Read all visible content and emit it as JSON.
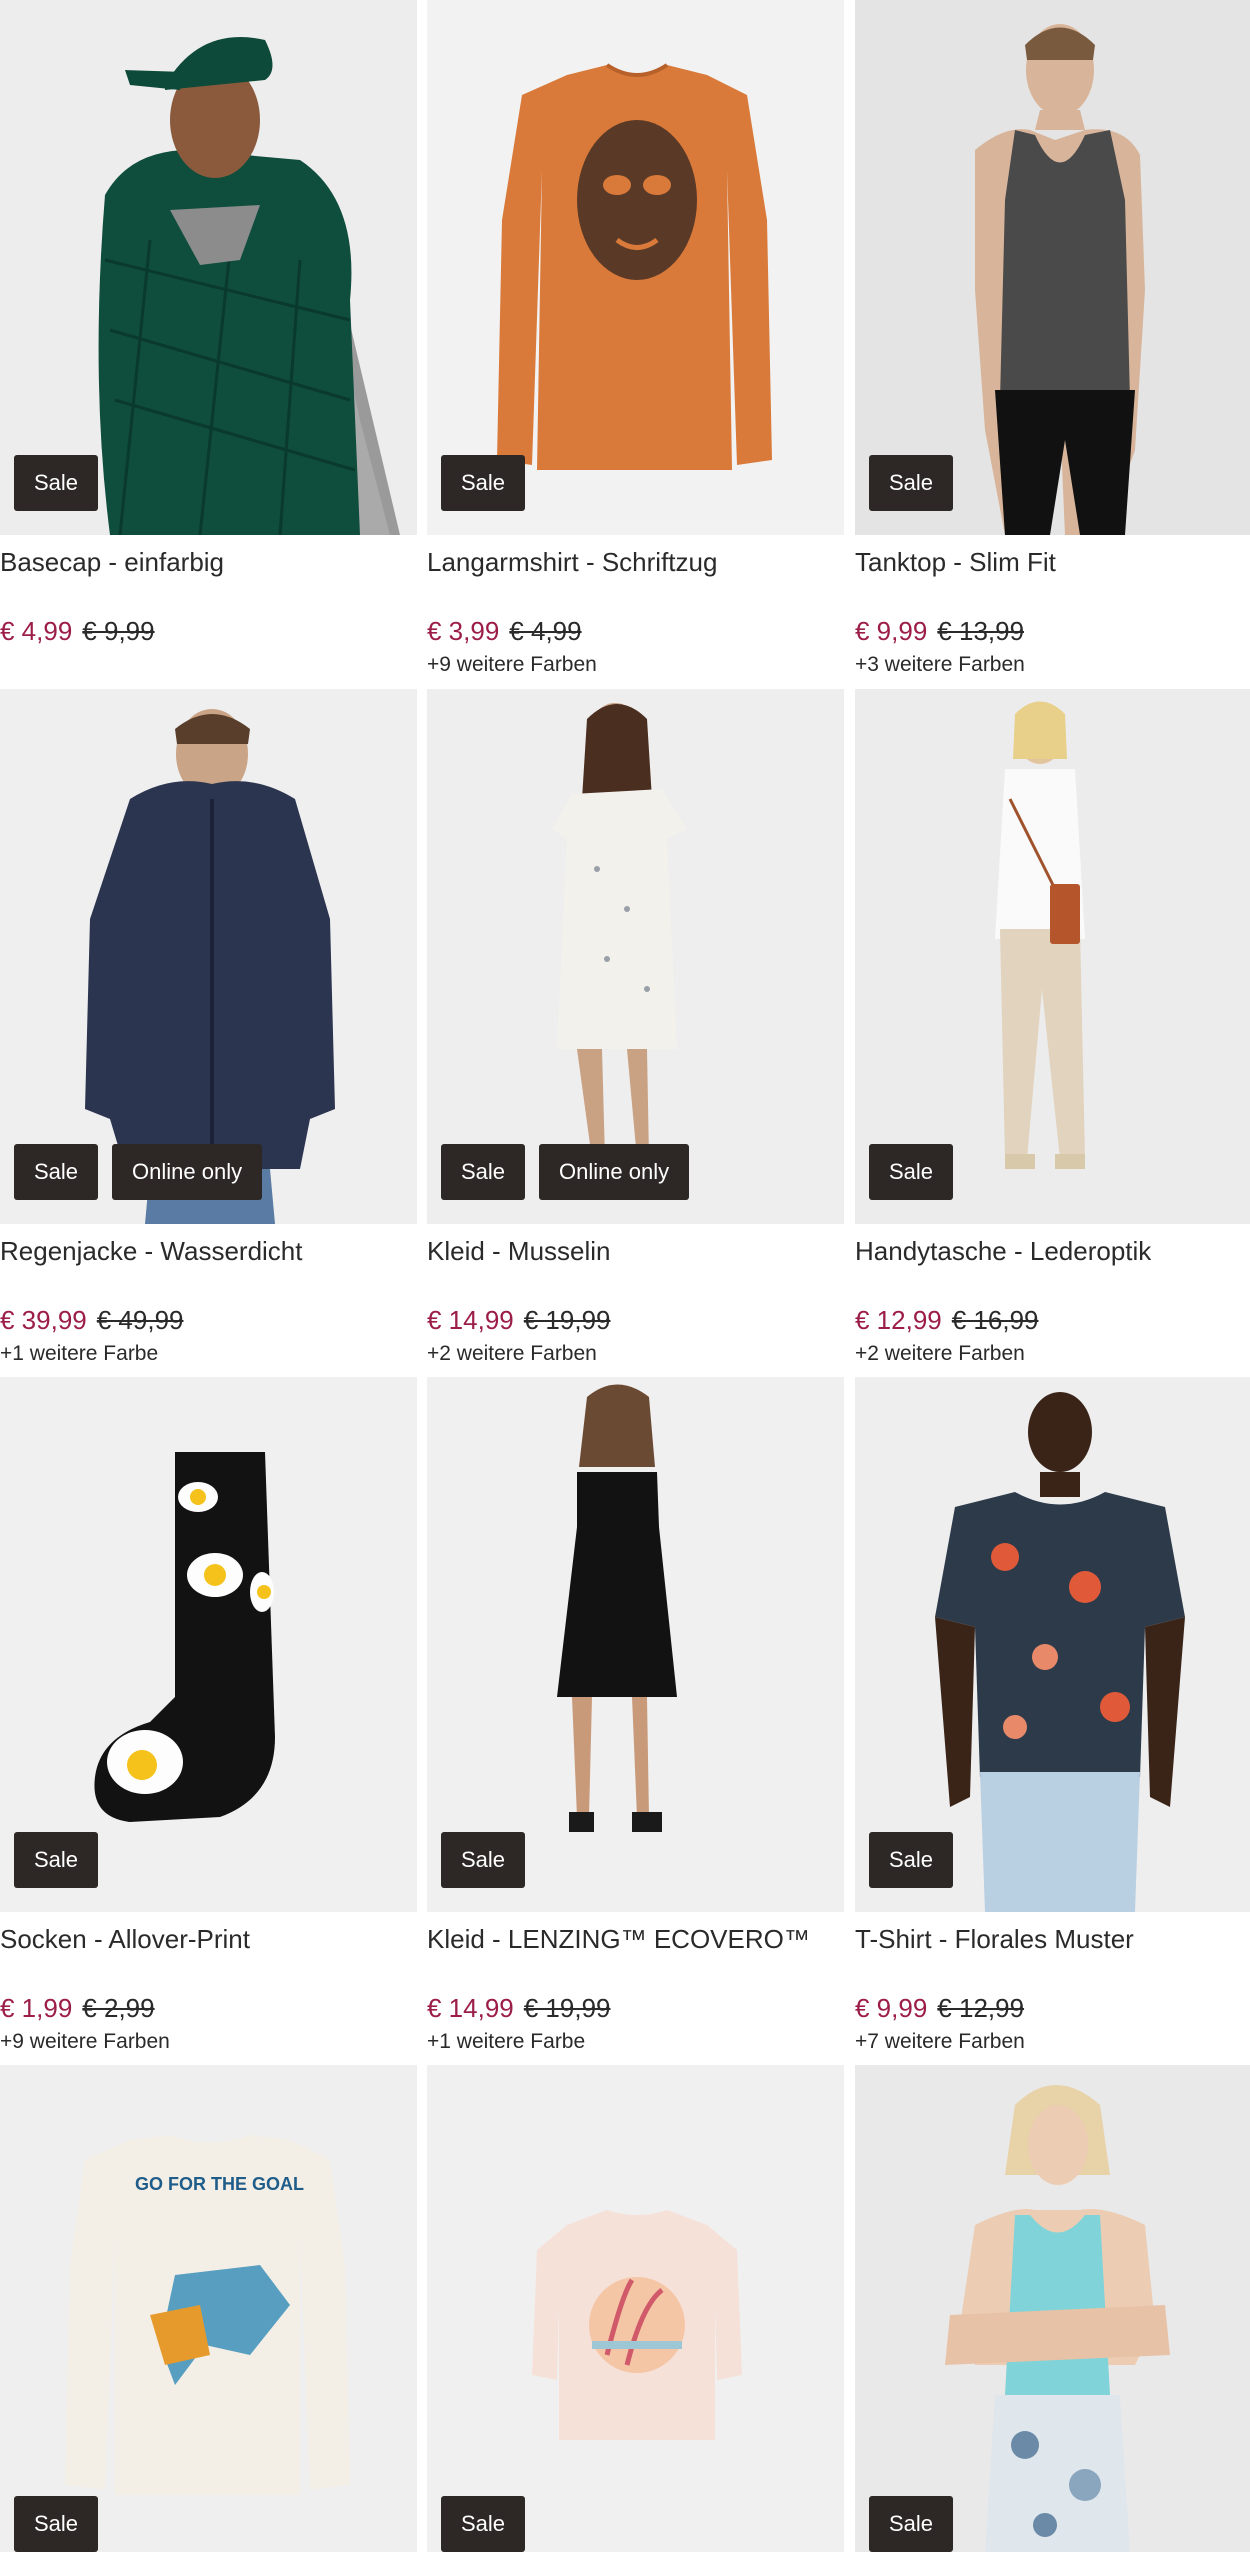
{
  "products": [
    {
      "title": "Basecap - einfarbig",
      "price": "€ 4,99",
      "old_price": "€ 9,99",
      "colors": "",
      "badges": [
        "Sale"
      ]
    },
    {
      "title": "Langarmshirt - Schriftzug",
      "price": "€ 3,99",
      "old_price": "€ 4,99",
      "colors": "+9 weitere Farben",
      "badges": [
        "Sale"
      ]
    },
    {
      "title": "Tanktop - Slim Fit",
      "price": "€ 9,99",
      "old_price": "€ 13,99",
      "colors": "+3 weitere Farben",
      "badges": [
        "Sale"
      ]
    },
    {
      "title": "Regenjacke - Wasserdicht",
      "price": "€ 39,99",
      "old_price": "€ 49,99",
      "colors": "+1 weitere Farbe",
      "badges": [
        "Sale",
        "Online only"
      ]
    },
    {
      "title": "Kleid - Musselin",
      "price": "€ 14,99",
      "old_price": "€ 19,99",
      "colors": "+2 weitere Farben",
      "badges": [
        "Sale",
        "Online only"
      ]
    },
    {
      "title": "Handytasche - Lederoptik",
      "price": "€ 12,99",
      "old_price": "€ 16,99",
      "colors": "+2 weitere Farben",
      "badges": [
        "Sale"
      ]
    },
    {
      "title": "Socken - Allover-Print",
      "price": "€ 1,99",
      "old_price": "€ 2,99",
      "colors": "+9 weitere Farben",
      "badges": [
        "Sale"
      ]
    },
    {
      "title": "Kleid - LENZING™ ECOVERO™",
      "price": "€ 14,99",
      "old_price": "€ 19,99",
      "colors": "+1 weitere Farbe",
      "badges": [
        "Sale"
      ]
    },
    {
      "title": "T-Shirt - Florales Muster",
      "price": "€ 9,99",
      "old_price": "€ 12,99",
      "colors": "+7 weitere Farben",
      "badges": [
        "Sale"
      ]
    },
    {
      "title": "",
      "price": "",
      "old_price": "",
      "colors": "",
      "badges": [
        "Sale"
      ]
    },
    {
      "title": "",
      "price": "",
      "old_price": "",
      "colors": "",
      "badges": [
        "Sale"
      ]
    },
    {
      "title": "",
      "price": "",
      "old_price": "",
      "colors": "",
      "badges": [
        "Sale"
      ]
    }
  ],
  "image_texts": {
    "shirt_print": "GO FOR THE GOAL"
  },
  "colors": {
    "sale_price": "#9c1e48",
    "badge_bg": "#2d2826",
    "badge_text": "#ffffff",
    "image_bg": "#efefef"
  }
}
